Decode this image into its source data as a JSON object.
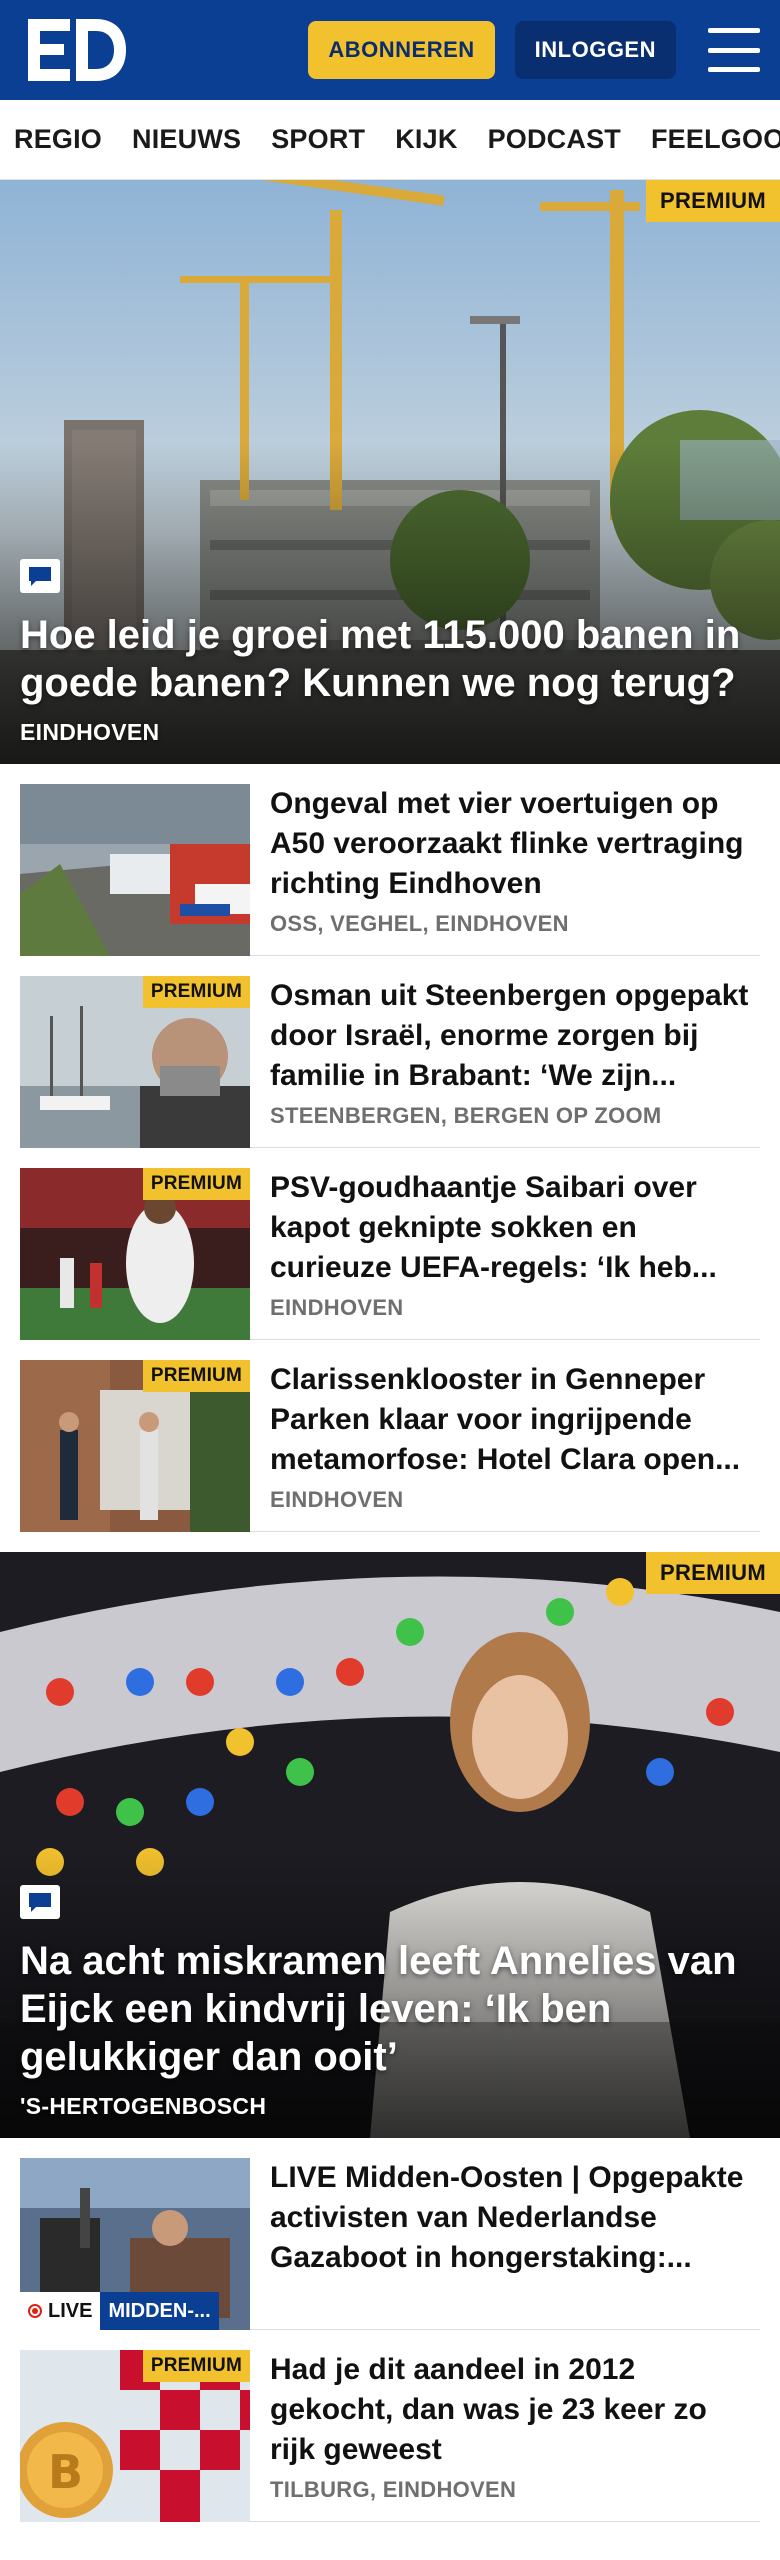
{
  "header": {
    "logo_text": "ED",
    "subscribe_label": "ABONNEREN",
    "login_label": "INLOGGEN",
    "menu_icon": "hamburger-menu-icon",
    "brand_color": "#0b3f94",
    "accent_color": "#f2c12e"
  },
  "nav": {
    "items": [
      "REGIO",
      "NIEUWS",
      "SPORT",
      "KIJK",
      "PODCAST",
      "FEELGOOD"
    ]
  },
  "hero1": {
    "premium": "PREMIUM",
    "title": "Hoe leid je groei met 115.000 banen in goede banen? Kunnen we nog terug?",
    "location": "EINDHOVEN"
  },
  "articles1": [
    {
      "title": "Ongeval met vier voertuigen op A50 veroorzaakt flinke vertraging richting Eindhoven",
      "location": "OSS, VEGHEL, EINDHOVEN",
      "premium": ""
    },
    {
      "title": "Osman uit Steenbergen opgepakt door Israël, enorme zorgen bij familie in Brabant: ‘We zijn...",
      "location": "STEENBERGEN, BERGEN OP ZOOM",
      "premium": "PREMIUM"
    },
    {
      "title": "PSV-goudhaantje Saibari over kapot geknipte sokken en curieuze UEFA-regels: ‘Ik heb...",
      "location": "EINDHOVEN",
      "premium": "PREMIUM"
    },
    {
      "title": "Clarissenklooster in Genneper Parken klaar voor ingrijpende metamorfose: Hotel Clara open...",
      "location": "EINDHOVEN",
      "premium": "PREMIUM"
    }
  ],
  "hero2": {
    "premium": "PREMIUM",
    "title": "Na acht miskramen leeft Annelies van Eijck een kindvrij leven: ‘Ik ben gelukkiger dan ooit’",
    "location": "'S-HERTOGENBOSCH"
  },
  "articles2": [
    {
      "title": "LIVE Midden-Oosten | Opgepakte activisten van Nederlandse Gazaboot in hongerstaking:...",
      "location": "",
      "live": "LIVE",
      "topic": "MIDDEN-..."
    },
    {
      "title": "Had je dit aandeel in 2012 gekocht, dan was je 23 keer zo rijk geweest",
      "location": "TILBURG, EINDHOVEN",
      "premium": "PREMIUM"
    }
  ]
}
